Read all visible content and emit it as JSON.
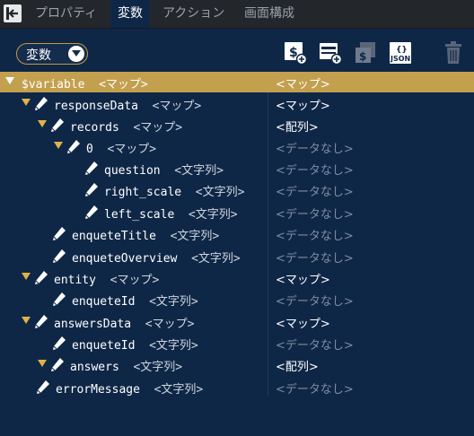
{
  "tabs": [
    {
      "label": "プロパティ",
      "active": false
    },
    {
      "label": "変数",
      "active": true
    },
    {
      "label": "アクション",
      "active": false
    },
    {
      "label": "画面構成",
      "active": false
    }
  ],
  "toolbar": {
    "variable_select": "変数",
    "icons": [
      "add-variable-icon",
      "add-record-icon",
      "copy-variable-icon",
      "json-import-icon",
      "trash-icon"
    ]
  },
  "colors": {
    "background": "#0f2747",
    "selected_row": "#c3a04e",
    "tab_bar": "#23272c"
  },
  "tree": [
    {
      "name": "$variable",
      "type": "<マップ>",
      "value": "<マップ>",
      "expanded": true,
      "selected": true
    },
    {
      "name": "responseData",
      "type": "<マップ>",
      "value": "<マップ>",
      "expanded": true
    },
    {
      "name": "records",
      "type": "<マップ>",
      "value": "<配列>",
      "expanded": true
    },
    {
      "name": "0",
      "type": "<マップ>",
      "value": "<データなし>",
      "expanded": true
    },
    {
      "name": "question",
      "type": "<文字列>",
      "value": "<データなし>"
    },
    {
      "name": "right_scale",
      "type": "<文字列>",
      "value": "<データなし>"
    },
    {
      "name": "left_scale",
      "type": "<文字列>",
      "value": "<データなし>"
    },
    {
      "name": "enqueteTitle",
      "type": "<文字列>",
      "value": "<データなし>"
    },
    {
      "name": "enqueteOverview",
      "type": "<文字列>",
      "value": "<データなし>"
    },
    {
      "name": "entity",
      "type": "<マップ>",
      "value": "<マップ>",
      "expanded": true
    },
    {
      "name": "enqueteId",
      "type": "<文字列>",
      "value": "<データなし>"
    },
    {
      "name": "answersData",
      "type": "<マップ>",
      "value": "<マップ>",
      "expanded": true
    },
    {
      "name": "enqueteId",
      "type": "<文字列>",
      "value": "<データなし>"
    },
    {
      "name": "answers",
      "type": "<文字列>",
      "value": "<配列>",
      "expanded": true
    },
    {
      "name": "errorMessage",
      "type": "<文字列>",
      "value": "<データなし>"
    }
  ]
}
